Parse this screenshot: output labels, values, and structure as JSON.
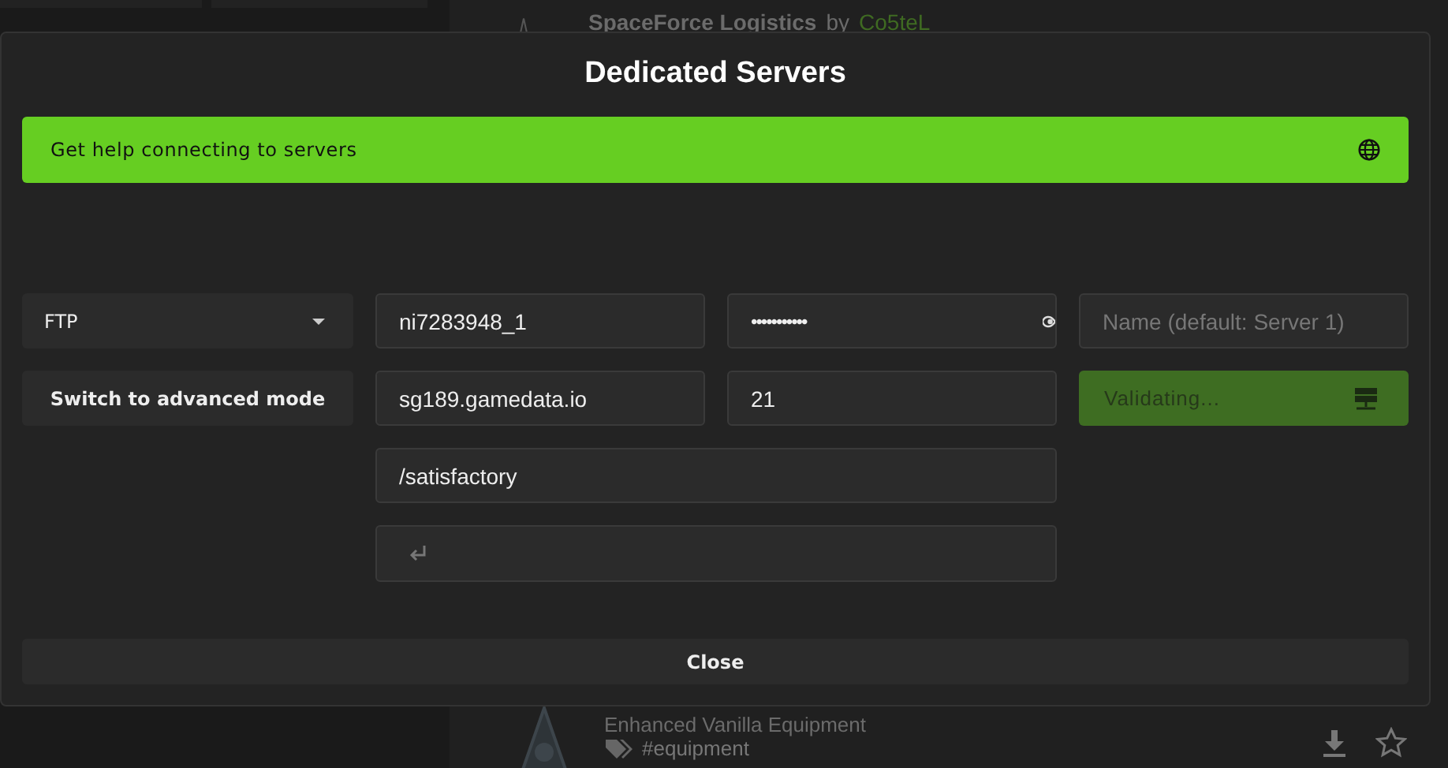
{
  "background": {
    "mods": [
      {
        "title": "SpaceForce Logistics",
        "by": "by",
        "author": "Co5teL"
      },
      {
        "title": "Enhanced Vanilla Equipment",
        "tag": "#equipment"
      }
    ]
  },
  "dialog": {
    "title": "Dedicated Servers",
    "help_link": "Get help connecting to servers",
    "protocol": "FTP",
    "username": "ni7283948_1",
    "password": "•••••••••••",
    "name_placeholder": "Name (default: Server 1)",
    "mode_button": "Switch to advanced mode",
    "host": "sg189.gamedata.io",
    "port": "21",
    "validate_button": {
      "label": "Validating...",
      "disabled": true
    },
    "path": "/satisfactory",
    "close_button": "Close"
  }
}
